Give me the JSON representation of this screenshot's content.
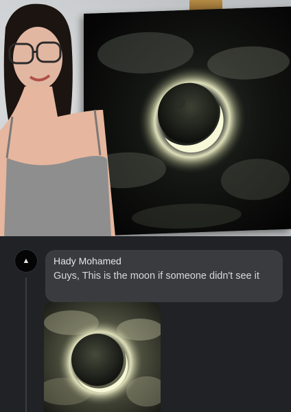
{
  "comment": {
    "author": "Hady Mohamed",
    "text": "Guys, This is the moon if someone didn't see it"
  },
  "icons": {
    "avatar": "user-avatar-icon",
    "avatar_glyph": "▲"
  },
  "colors": {
    "background": "#1f2125",
    "bubble": "#3a3b3f",
    "author_text": "#e6e6e6",
    "comment_text": "#d9d9d9",
    "moon_glow": "#e8ecb8"
  }
}
